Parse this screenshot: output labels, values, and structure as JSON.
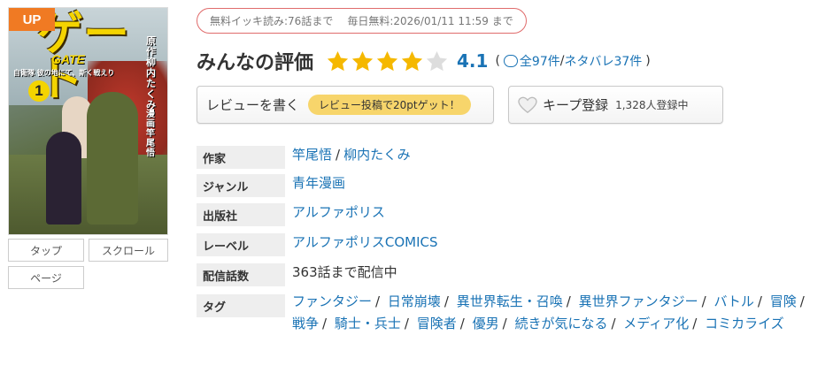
{
  "cover": {
    "badge": "UP",
    "title": "ゲート",
    "logo_latin": "GATE",
    "subtitle": "自衛隊 彼の地にて、斯く戦えり",
    "volume": "1",
    "original_author_vertical": "原作 柳内たくみ",
    "artist_vertical": "漫画 竿尾悟"
  },
  "view_buttons": {
    "tap": "タップ",
    "scroll": "スクロール",
    "page": "ページ"
  },
  "free_info": {
    "ikki": "無料イッキ読み:76話まで",
    "daily": "毎日無料:2026/01/11 11:59 まで"
  },
  "rating": {
    "title": "みんなの評価",
    "value": "4.1",
    "stars_filled": 4,
    "stars_total": 5,
    "open_paren": "(",
    "total_count": "全97件",
    "slash": "/",
    "spoiler_count": "ネタバレ37件",
    "close_paren": ")"
  },
  "actions": {
    "review_label": "レビューを書く",
    "review_promo": "レビュー投稿で20ptゲット！",
    "keep_label": "キープ登録",
    "keep_count": "1,328人登録中"
  },
  "info": {
    "author_label": "作家",
    "authors": [
      "竿尾悟",
      "柳内たくみ"
    ],
    "genre_label": "ジャンル",
    "genre": "青年漫画",
    "publisher_label": "出版社",
    "publisher": "アルファポリス",
    "label_label": "レーベル",
    "label": "アルファポリスCOMICS",
    "episodes_label": "配信話数",
    "episodes": "363話まで配信中",
    "tags_label": "タグ",
    "tags": [
      "ファンタジー",
      "日常崩壊",
      "異世界転生・召喚",
      "異世界ファンタジー",
      "バトル",
      "冒険",
      "戦争",
      "騎士・兵士",
      "冒険者",
      "優男",
      "続きが気になる",
      "メディア化",
      "コミカライズ"
    ]
  },
  "colors": {
    "accent_orange": "#f07a23",
    "link_blue": "#1a73b5",
    "star_gold": "#f5b800",
    "star_empty": "#dddddd",
    "promo_yellow": "#f7d56b",
    "badge_border": "#e06c6c"
  }
}
